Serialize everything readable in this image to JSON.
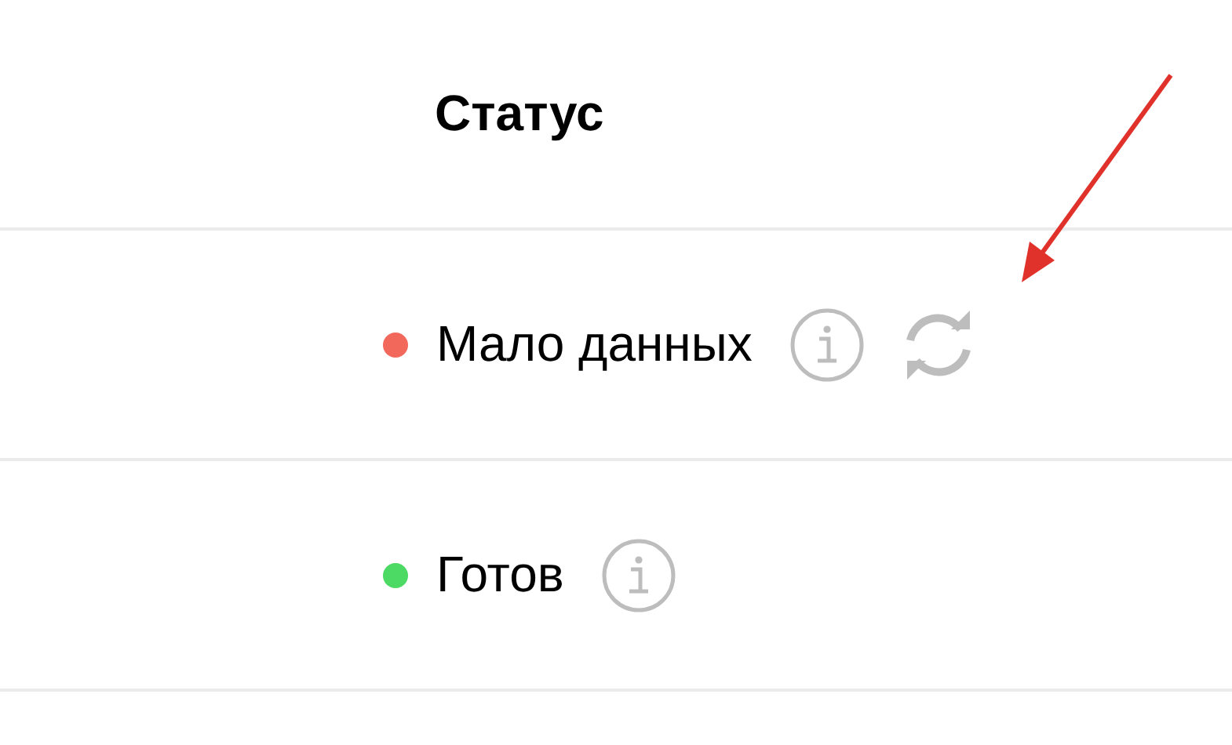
{
  "table": {
    "columns": [
      {
        "label": "Статус"
      }
    ],
    "rows": [
      {
        "status": "Мало данных",
        "color": "#f2695c",
        "refresh": true
      },
      {
        "status": "Готов",
        "color": "#4cd964",
        "refresh": false
      }
    ]
  }
}
